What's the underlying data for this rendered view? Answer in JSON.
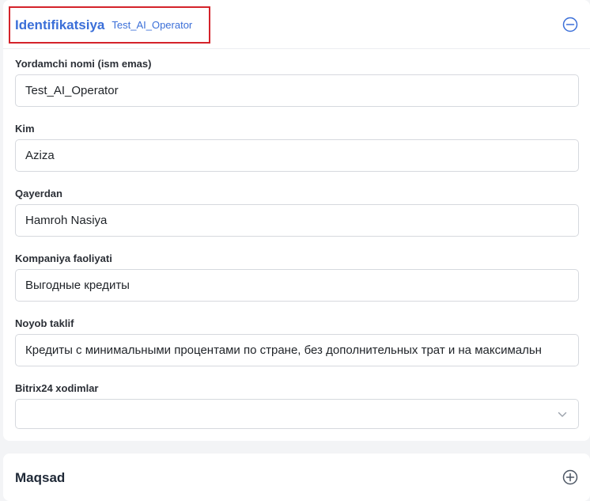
{
  "identification": {
    "title": "Identifikatsiya",
    "subtitle": "Test_AI_Operator",
    "collapse_icon": "minus-circle-icon",
    "fields": [
      {
        "label": "Yordamchi nomi (ism emas)",
        "value": "Test_AI_Operator"
      },
      {
        "label": "Kim",
        "value": "Aziza"
      },
      {
        "label": "Qayerdan",
        "value": "Hamroh Nasiya"
      },
      {
        "label": "Kompaniya faoliyati",
        "value": "Выгодные кредиты"
      },
      {
        "label": "Noyob taklif",
        "value": "Кредиты с минимальными процентами по стране, без дополнительных трат и на максимальн"
      },
      {
        "label": "Bitrix24 xodimlar",
        "value": ""
      }
    ]
  },
  "maqsad": {
    "title": "Maqsad",
    "expand_icon": "plus-circle-icon"
  },
  "colors": {
    "accent": "#3b6fd8",
    "highlight_border": "#d4232b"
  }
}
